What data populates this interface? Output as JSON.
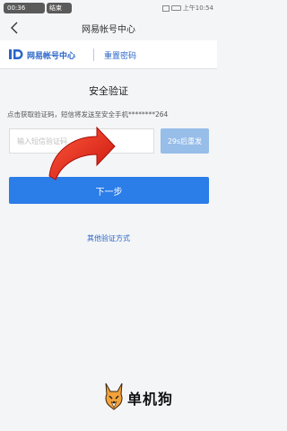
{
  "status_bar": {
    "call_time": "00:36",
    "end_label": "结束",
    "clock": "上午10:54",
    "icons": [
      "signal-icon",
      "wifi-icon",
      "battery-icon"
    ]
  },
  "nav": {
    "back_icon": "back-chevron-icon",
    "title": "网易帐号中心"
  },
  "brand": {
    "name": "网易帐号中心",
    "section": "重置密码",
    "color": "#2b66c8"
  },
  "verify": {
    "heading": "安全验证",
    "notice": "点击获取验证码，短信将发送至安全手机********264",
    "code_placeholder": "输入短信验证码",
    "code_value": "",
    "resend_label": "29s后重发",
    "next_label": "下一步",
    "other_methods_label": "其他验证方式",
    "primary_color": "#2b7de8",
    "disabled_color": "#97bde9"
  },
  "overlay": {
    "arrow_color": "#e8241c",
    "watermark_text": "单机狗"
  }
}
